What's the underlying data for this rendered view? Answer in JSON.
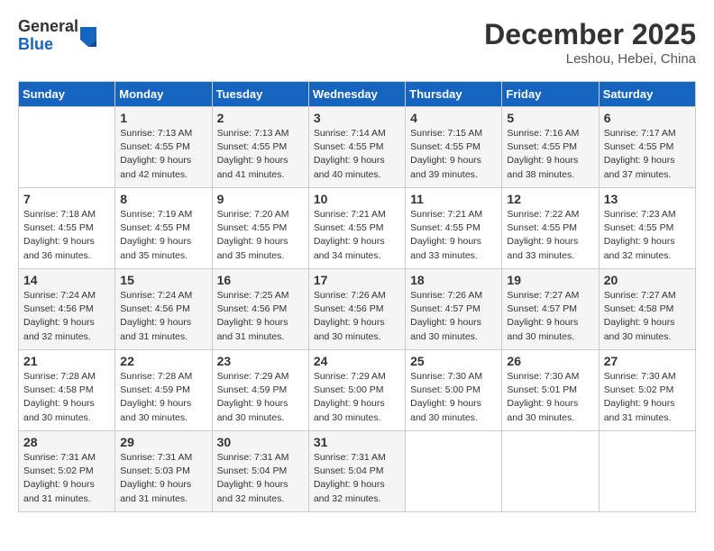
{
  "logo": {
    "general": "General",
    "blue": "Blue"
  },
  "header": {
    "month": "December 2025",
    "location": "Leshou, Hebei, China"
  },
  "weekdays": [
    "Sunday",
    "Monday",
    "Tuesday",
    "Wednesday",
    "Thursday",
    "Friday",
    "Saturday"
  ],
  "weeks": [
    [
      {
        "day": "",
        "info": ""
      },
      {
        "day": "1",
        "info": "Sunrise: 7:13 AM\nSunset: 4:55 PM\nDaylight: 9 hours\nand 42 minutes."
      },
      {
        "day": "2",
        "info": "Sunrise: 7:13 AM\nSunset: 4:55 PM\nDaylight: 9 hours\nand 41 minutes."
      },
      {
        "day": "3",
        "info": "Sunrise: 7:14 AM\nSunset: 4:55 PM\nDaylight: 9 hours\nand 40 minutes."
      },
      {
        "day": "4",
        "info": "Sunrise: 7:15 AM\nSunset: 4:55 PM\nDaylight: 9 hours\nand 39 minutes."
      },
      {
        "day": "5",
        "info": "Sunrise: 7:16 AM\nSunset: 4:55 PM\nDaylight: 9 hours\nand 38 minutes."
      },
      {
        "day": "6",
        "info": "Sunrise: 7:17 AM\nSunset: 4:55 PM\nDaylight: 9 hours\nand 37 minutes."
      }
    ],
    [
      {
        "day": "7",
        "info": "Sunrise: 7:18 AM\nSunset: 4:55 PM\nDaylight: 9 hours\nand 36 minutes."
      },
      {
        "day": "8",
        "info": "Sunrise: 7:19 AM\nSunset: 4:55 PM\nDaylight: 9 hours\nand 35 minutes."
      },
      {
        "day": "9",
        "info": "Sunrise: 7:20 AM\nSunset: 4:55 PM\nDaylight: 9 hours\nand 35 minutes."
      },
      {
        "day": "10",
        "info": "Sunrise: 7:21 AM\nSunset: 4:55 PM\nDaylight: 9 hours\nand 34 minutes."
      },
      {
        "day": "11",
        "info": "Sunrise: 7:21 AM\nSunset: 4:55 PM\nDaylight: 9 hours\nand 33 minutes."
      },
      {
        "day": "12",
        "info": "Sunrise: 7:22 AM\nSunset: 4:55 PM\nDaylight: 9 hours\nand 33 minutes."
      },
      {
        "day": "13",
        "info": "Sunrise: 7:23 AM\nSunset: 4:55 PM\nDaylight: 9 hours\nand 32 minutes."
      }
    ],
    [
      {
        "day": "14",
        "info": "Sunrise: 7:24 AM\nSunset: 4:56 PM\nDaylight: 9 hours\nand 32 minutes."
      },
      {
        "day": "15",
        "info": "Sunrise: 7:24 AM\nSunset: 4:56 PM\nDaylight: 9 hours\nand 31 minutes."
      },
      {
        "day": "16",
        "info": "Sunrise: 7:25 AM\nSunset: 4:56 PM\nDaylight: 9 hours\nand 31 minutes."
      },
      {
        "day": "17",
        "info": "Sunrise: 7:26 AM\nSunset: 4:56 PM\nDaylight: 9 hours\nand 30 minutes."
      },
      {
        "day": "18",
        "info": "Sunrise: 7:26 AM\nSunset: 4:57 PM\nDaylight: 9 hours\nand 30 minutes."
      },
      {
        "day": "19",
        "info": "Sunrise: 7:27 AM\nSunset: 4:57 PM\nDaylight: 9 hours\nand 30 minutes."
      },
      {
        "day": "20",
        "info": "Sunrise: 7:27 AM\nSunset: 4:58 PM\nDaylight: 9 hours\nand 30 minutes."
      }
    ],
    [
      {
        "day": "21",
        "info": "Sunrise: 7:28 AM\nSunset: 4:58 PM\nDaylight: 9 hours\nand 30 minutes."
      },
      {
        "day": "22",
        "info": "Sunrise: 7:28 AM\nSunset: 4:59 PM\nDaylight: 9 hours\nand 30 minutes."
      },
      {
        "day": "23",
        "info": "Sunrise: 7:29 AM\nSunset: 4:59 PM\nDaylight: 9 hours\nand 30 minutes."
      },
      {
        "day": "24",
        "info": "Sunrise: 7:29 AM\nSunset: 5:00 PM\nDaylight: 9 hours\nand 30 minutes."
      },
      {
        "day": "25",
        "info": "Sunrise: 7:30 AM\nSunset: 5:00 PM\nDaylight: 9 hours\nand 30 minutes."
      },
      {
        "day": "26",
        "info": "Sunrise: 7:30 AM\nSunset: 5:01 PM\nDaylight: 9 hours\nand 30 minutes."
      },
      {
        "day": "27",
        "info": "Sunrise: 7:30 AM\nSunset: 5:02 PM\nDaylight: 9 hours\nand 31 minutes."
      }
    ],
    [
      {
        "day": "28",
        "info": "Sunrise: 7:31 AM\nSunset: 5:02 PM\nDaylight: 9 hours\nand 31 minutes."
      },
      {
        "day": "29",
        "info": "Sunrise: 7:31 AM\nSunset: 5:03 PM\nDaylight: 9 hours\nand 31 minutes."
      },
      {
        "day": "30",
        "info": "Sunrise: 7:31 AM\nSunset: 5:04 PM\nDaylight: 9 hours\nand 32 minutes."
      },
      {
        "day": "31",
        "info": "Sunrise: 7:31 AM\nSunset: 5:04 PM\nDaylight: 9 hours\nand 32 minutes."
      },
      {
        "day": "",
        "info": ""
      },
      {
        "day": "",
        "info": ""
      },
      {
        "day": "",
        "info": ""
      }
    ]
  ]
}
